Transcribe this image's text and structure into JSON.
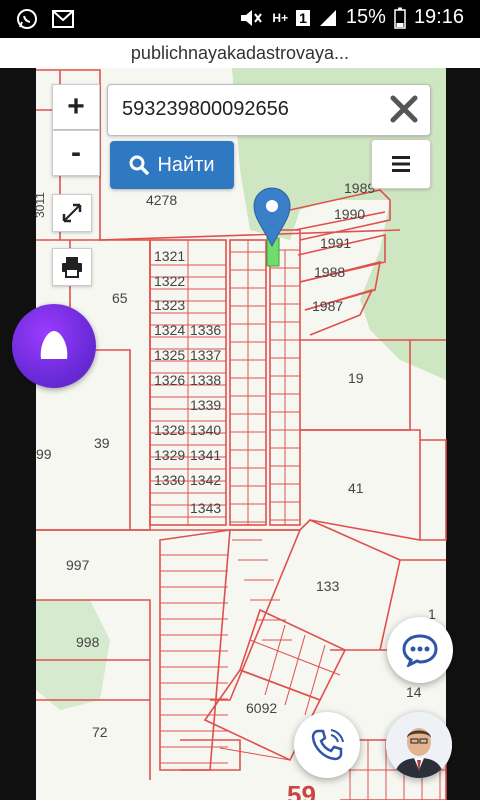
{
  "status_bar": {
    "battery": "15%",
    "network": "H+",
    "sim": "1",
    "time": "19:16"
  },
  "browser": {
    "url": "publichnayakadastrovaya..."
  },
  "map_controls": {
    "zoom_in": "+",
    "zoom_out": "-"
  },
  "search": {
    "value": "593239800092656",
    "find_label": "Найти"
  },
  "parcels": {
    "labels": [
      "4278",
      "1989",
      "1990",
      "1991",
      "1988",
      "1987",
      "1321",
      "1322",
      "1323",
      "1324",
      "1336",
      "1325",
      "1337",
      "1326",
      "1338",
      "1339",
      "1328",
      "1340",
      "1329",
      "1341",
      "1330",
      "1342",
      "1343",
      "3011",
      "65",
      "19",
      "39",
      "41",
      "99",
      "997",
      "133",
      "998",
      "1",
      "14",
      "6092",
      "72",
      "59"
    ]
  },
  "colors": {
    "parcel_border": "#e0504d",
    "vegetation": "#cfe6c2",
    "marker": "#3a7fc8",
    "selected_parcel": "#6fdc6f",
    "find_button": "#2f78c2",
    "alice": "#7a2fe6"
  }
}
